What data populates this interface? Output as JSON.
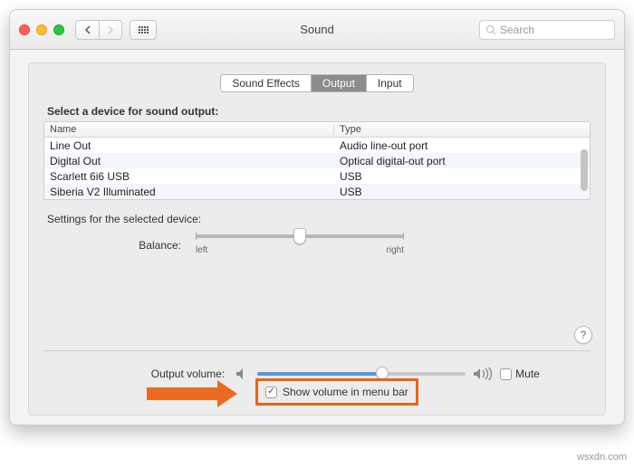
{
  "toolbar": {
    "title": "Sound",
    "search_placeholder": "Search"
  },
  "tabs": [
    {
      "label": "Sound Effects",
      "active": false
    },
    {
      "label": "Output",
      "active": true
    },
    {
      "label": "Input",
      "active": false
    }
  ],
  "section_title": "Select a device for sound output:",
  "table": {
    "headers": {
      "name": "Name",
      "type": "Type"
    },
    "rows": [
      {
        "name": "Line Out",
        "type": "Audio line-out port"
      },
      {
        "name": "Digital Out",
        "type": "Optical digital-out port"
      },
      {
        "name": "Scarlett 6i6 USB",
        "type": "USB"
      },
      {
        "name": "Siberia V2 Illuminated",
        "type": "USB"
      }
    ]
  },
  "settings_label": "Settings for the selected device:",
  "balance": {
    "label": "Balance:",
    "left": "left",
    "right": "right"
  },
  "output_volume": {
    "label": "Output volume:",
    "mute": "Mute",
    "show_in_menu": "Show volume in menu bar"
  },
  "watermark": "wsxdn.com"
}
